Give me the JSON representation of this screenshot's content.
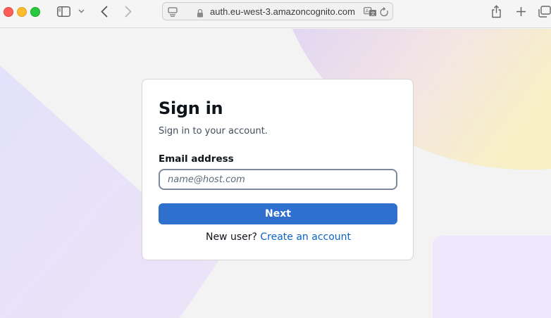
{
  "browser": {
    "url": "auth.eu-west-3.amazoncognito.com",
    "icons": {
      "close": "close-icon",
      "minimize": "minimize-icon",
      "maximize": "maximize-icon",
      "sidebar": "sidebar-icon",
      "sidebar_menu": "chevron-down-icon",
      "back": "back-icon",
      "forward": "forward-icon",
      "page_menu": "page-menu-icon",
      "lock": "lock-icon",
      "translate": "translate-icon",
      "reload": "reload-icon",
      "share": "share-icon",
      "new_tab": "plus-icon",
      "tabs_overview": "tabs-icon"
    }
  },
  "signin": {
    "title": "Sign in",
    "subtitle": "Sign in to your account.",
    "email_label": "Email address",
    "email_placeholder": "name@host.com",
    "email_value": "",
    "next_label": "Next",
    "new_user_text": "New user?",
    "create_account_label": "Create an account"
  },
  "colors": {
    "primary_button": "#2f6fcd",
    "link": "#0a65c2",
    "background": "#f3f3f3"
  }
}
